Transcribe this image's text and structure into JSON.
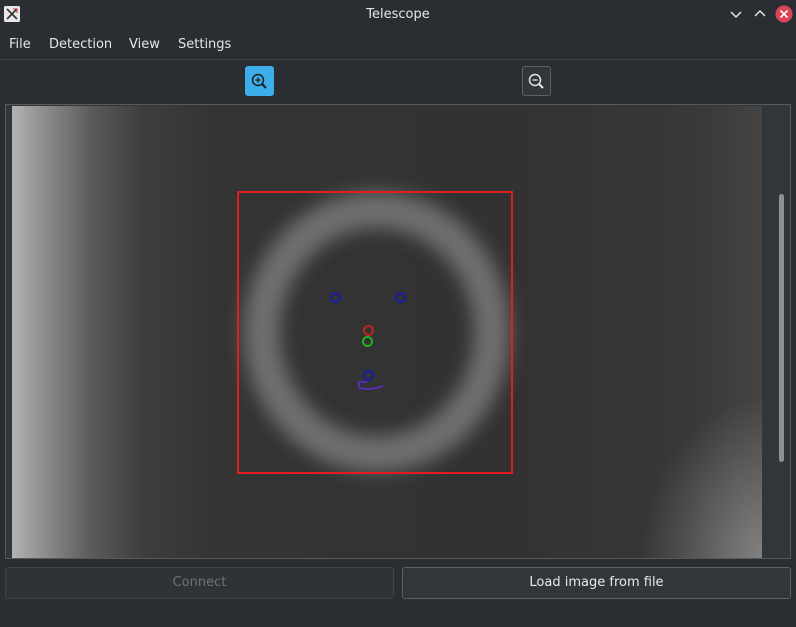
{
  "window": {
    "title": "Telescope",
    "icon": "x11-app-icon"
  },
  "menubar": {
    "items": [
      {
        "label": "File"
      },
      {
        "label": "Detection"
      },
      {
        "label": "View"
      },
      {
        "label": "Settings"
      }
    ]
  },
  "toolbar": {
    "zoom_in_icon": "zoom-in-icon",
    "zoom_out_icon": "zoom-out-icon",
    "zoom_in_active": true
  },
  "image_view": {
    "roi_color": "#e11d1d",
    "markers": [
      {
        "color": "#1a1aa8",
        "name": "marker-blue-left"
      },
      {
        "color": "#1a1aa8",
        "name": "marker-blue-right"
      },
      {
        "color": "#c42222",
        "name": "marker-red-center"
      },
      {
        "color": "#1db31d",
        "name": "marker-green-center"
      },
      {
        "color": "#1a1aa8",
        "name": "marker-blue-bottom"
      }
    ]
  },
  "buttons": {
    "connect": "Connect",
    "connect_enabled": false,
    "load": "Load image from file"
  },
  "colors": {
    "accent": "#3daee9",
    "background": "#2a2e32"
  }
}
